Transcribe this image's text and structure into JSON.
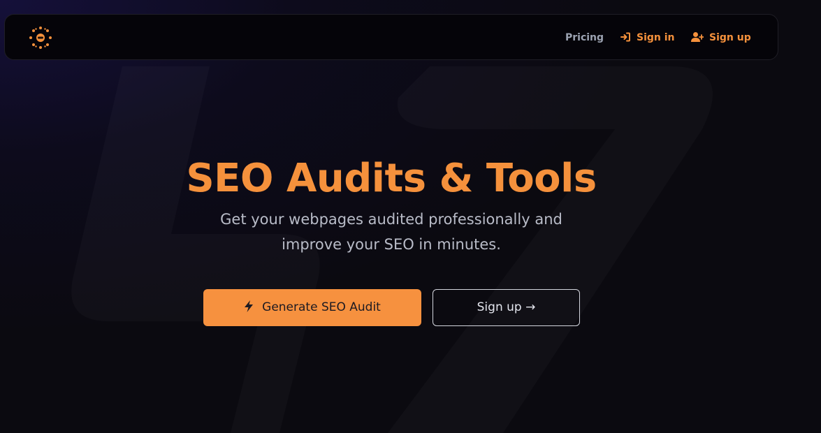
{
  "nav": {
    "pricing": "Pricing",
    "sign_in": "Sign in",
    "sign_up": "Sign up"
  },
  "hero": {
    "title": "SEO Audits & Tools",
    "subtitle": "Get your webpages audited professionally and improve your SEO in minutes.",
    "primary_button": "Generate SEO Audit",
    "secondary_button": "Sign up →"
  },
  "icons": {
    "logo": "sun-logo-icon",
    "sign_in": "sign-in-arrow-icon",
    "sign_up": "user-plus-icon",
    "primary_button": "lightning-bolt-icon"
  },
  "colors": {
    "accent": "#f5913c",
    "background": "#0b0a10",
    "nav_text": "#9ca3b2",
    "subtitle_text": "#b9bcc8"
  }
}
